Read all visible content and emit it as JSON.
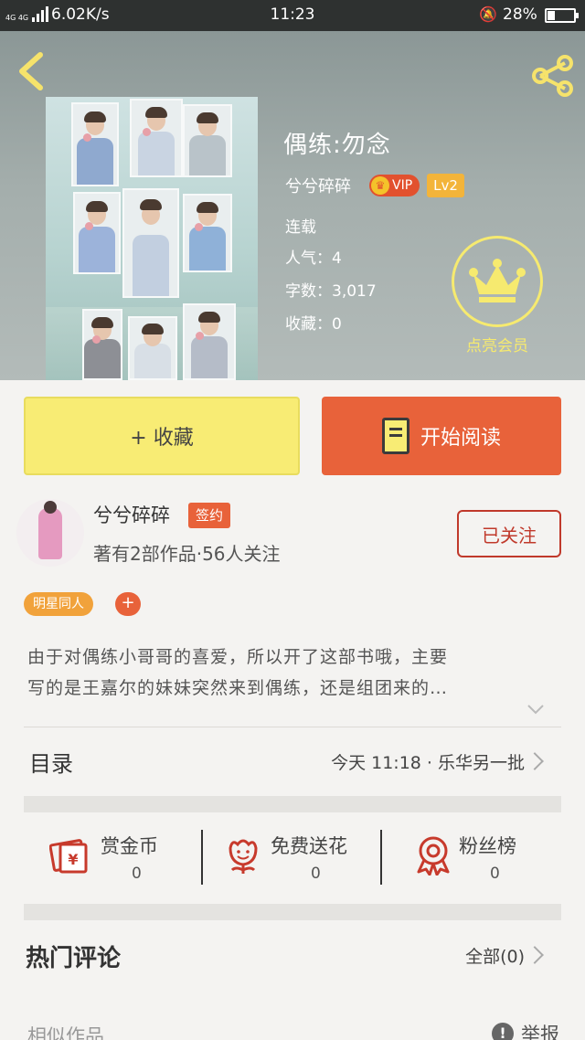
{
  "status_bar": {
    "network": "4G 4G",
    "speed": "6.02K/s",
    "time": "11:23",
    "battery": "28%"
  },
  "book": {
    "title": "偶练:勿念",
    "author": "兮兮碎碎",
    "vip_label": "VIP",
    "level": "Lv2",
    "status": "连载",
    "popularity": "人气：4",
    "word_count": "字数：3,017",
    "favorites": "收藏：0"
  },
  "member": {
    "label": "点亮会员"
  },
  "actions": {
    "favorite": "+ 收藏",
    "read": "开始阅读"
  },
  "author": {
    "name": "兮兮碎碎",
    "badge": "签约",
    "subtitle": "著有2部作品·56人关注",
    "follow": "已关注"
  },
  "tags": {
    "items": [
      "明星同人"
    ],
    "add": "+"
  },
  "description": {
    "line1": "由于对偶练小哥哥的喜爱，所以开了这部书哦，主要",
    "line2": "写的是王嘉尔的妹妹突然来到偶练，还是组团来的…"
  },
  "toc": {
    "label": "目录",
    "latest": "今天 11:18 · 乐华另一批"
  },
  "stats": {
    "items": [
      {
        "label": "赏金币",
        "value": "0",
        "icon": "red-envelope-icon"
      },
      {
        "label": "免费送花",
        "value": "0",
        "icon": "flower-icon"
      },
      {
        "label": "粉丝榜",
        "value": "0",
        "icon": "ribbon-icon"
      }
    ]
  },
  "comments": {
    "label": "热门评论",
    "all": "全部(0)"
  },
  "footer": {
    "similar": "相似作品",
    "report": "举报"
  },
  "colors": {
    "accent_orange": "#e8623a",
    "accent_yellow": "#f8ec74",
    "member_yellow": "#f6ea6f",
    "follow_red": "#c0392b",
    "tag_orange": "#f1a23b"
  }
}
